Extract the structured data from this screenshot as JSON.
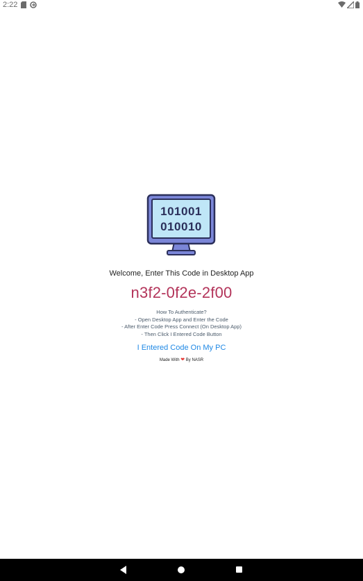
{
  "status_bar": {
    "time": "2:22",
    "left_icons": [
      "sd-card-icon",
      "sync-icon"
    ],
    "right_icons": [
      "wifi-icon",
      "signal-icon",
      "battery-icon"
    ]
  },
  "illustration": {
    "icon": "binary-monitor-icon",
    "line1": "101001",
    "line2": "010010"
  },
  "welcome": "Welcome, Enter This Code in Desktop App",
  "code": "n3f2-0f2e-2f00",
  "instructions": {
    "title": "How To Authenticate?",
    "steps": [
      "- Open Desktop App and Enter the Code",
      "- After Enter Code Press Connect (On Desktop App)",
      "- Then Click I Entered Code Button"
    ]
  },
  "entered_button": "I Entered Code On My PC",
  "credit": {
    "prefix": "Made With",
    "heart": "❤",
    "suffix": "By NASR"
  },
  "colors": {
    "code": "#b3345a",
    "button": "#1e88e5",
    "monitor_frame": "#2b2f5a",
    "monitor_body": "#7b86d8",
    "monitor_screen": "#bfe6f7"
  }
}
